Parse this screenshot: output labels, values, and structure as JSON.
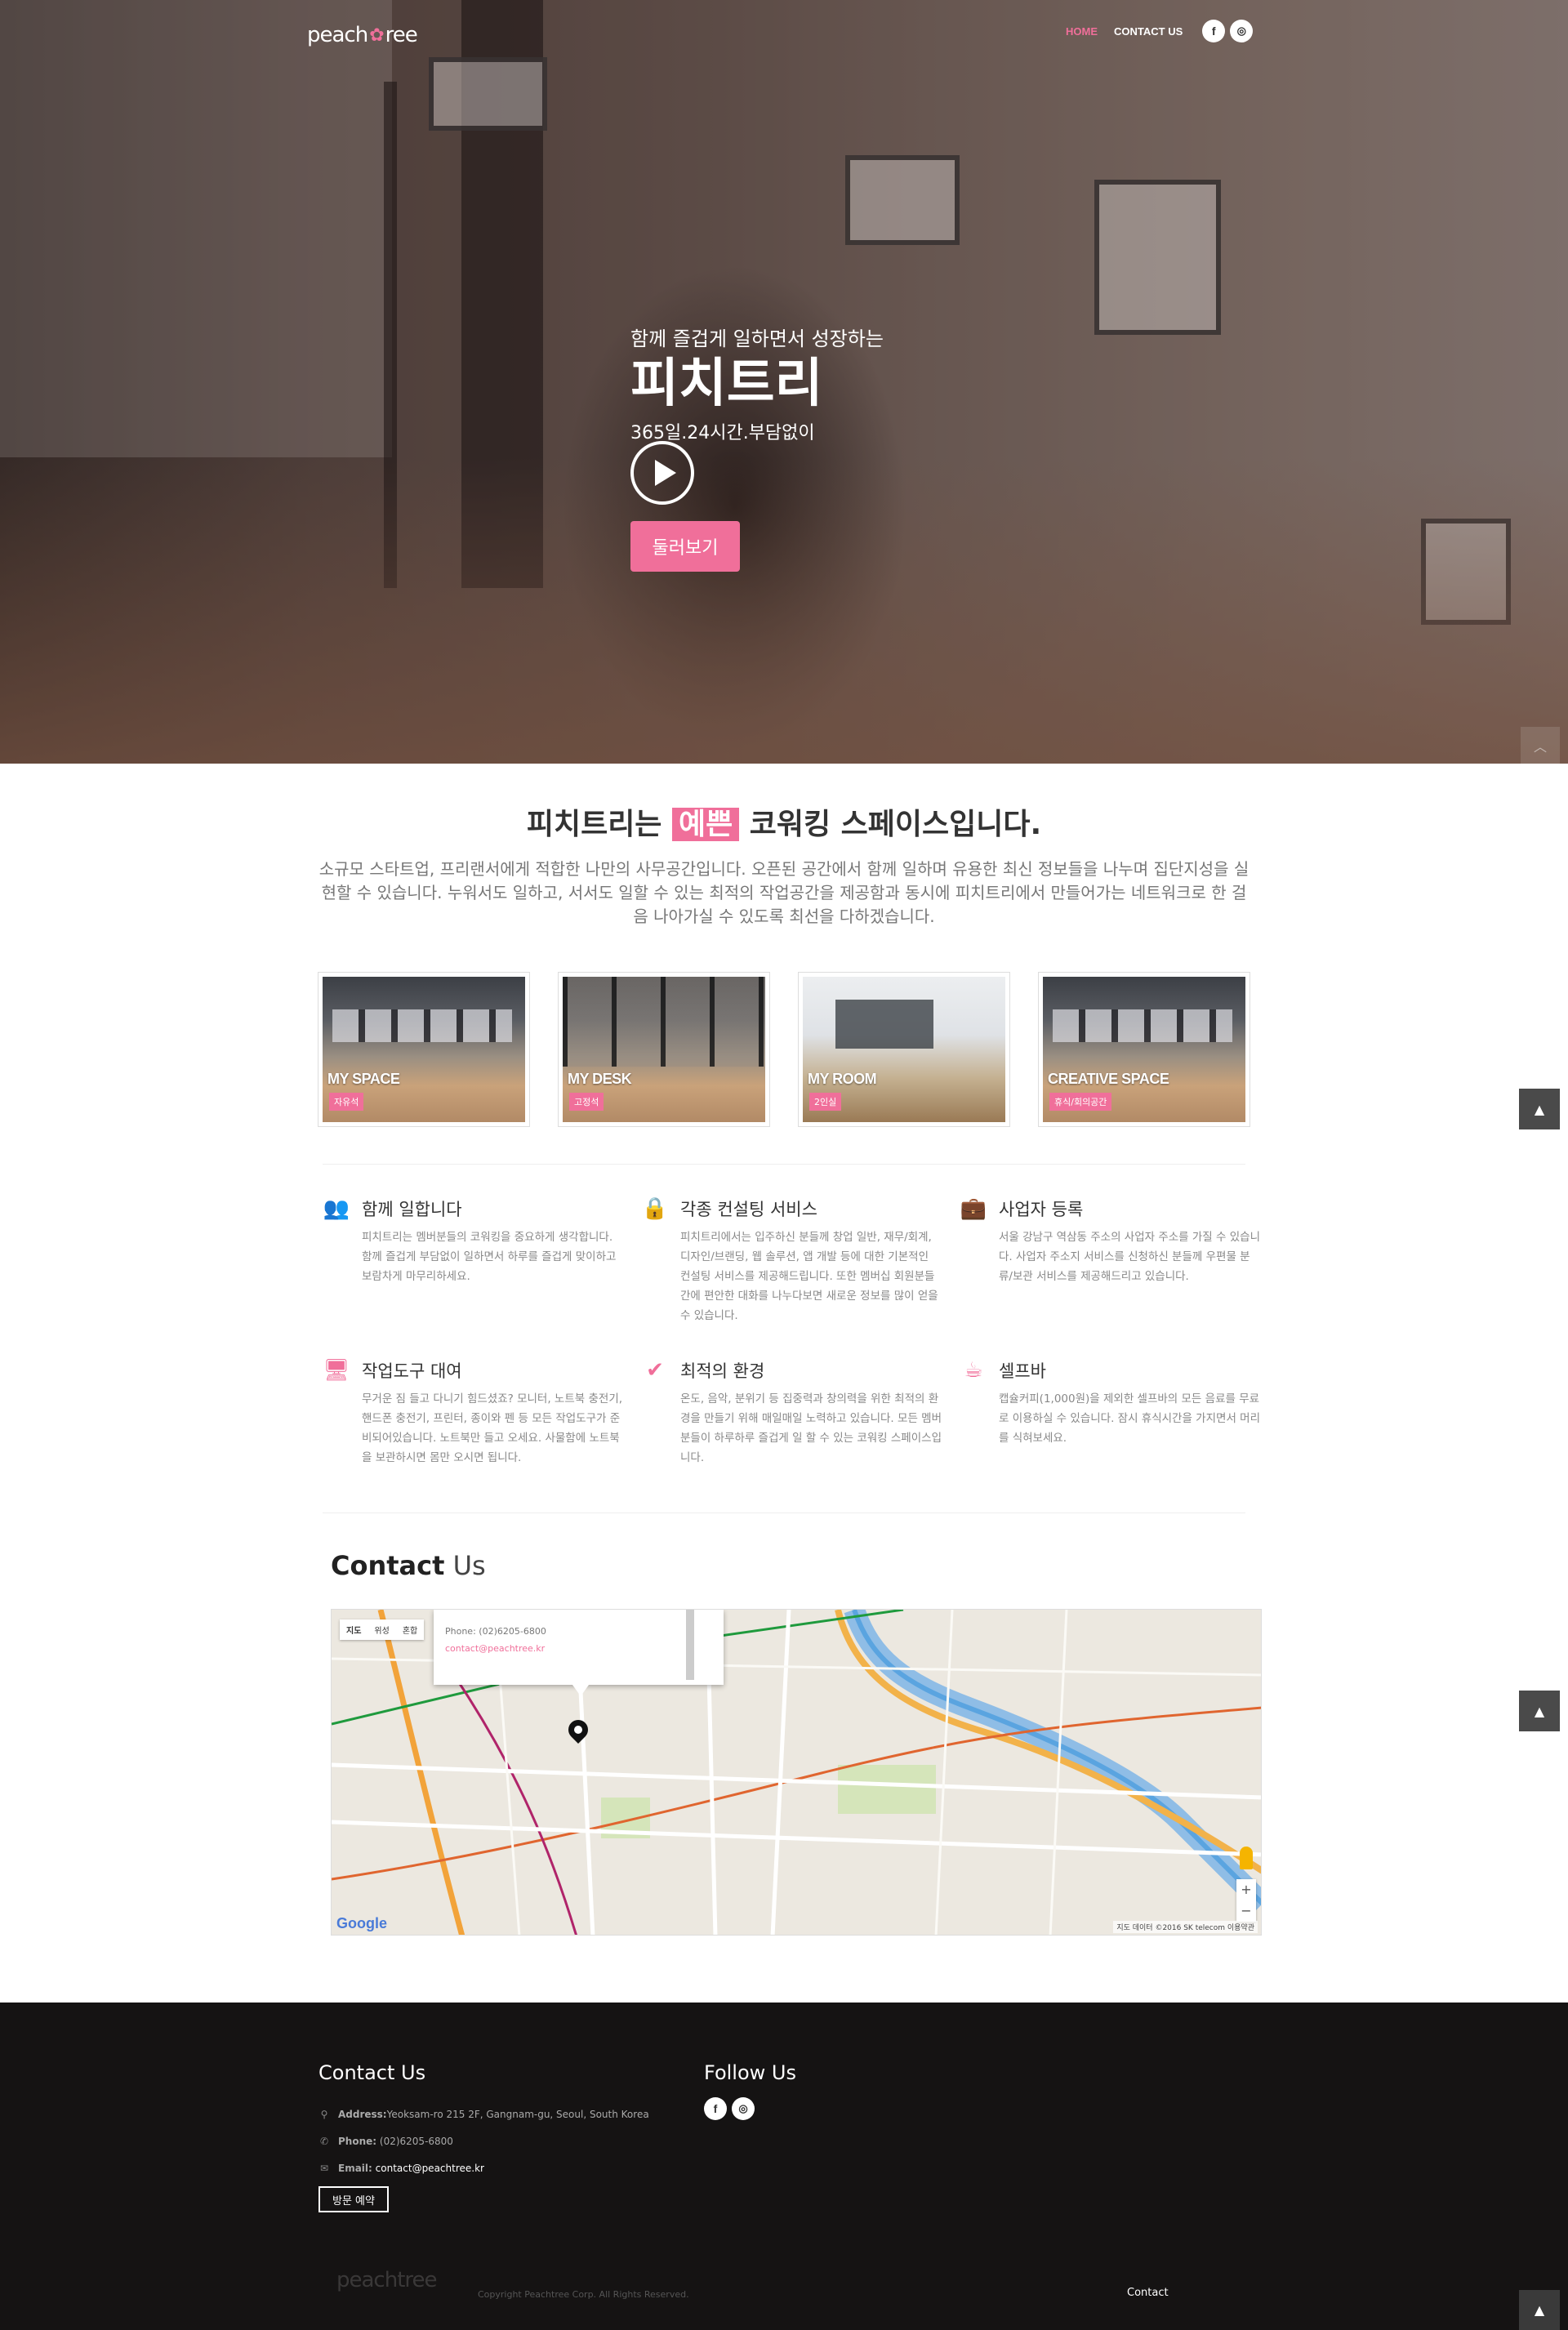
{
  "header": {
    "logo_text_left": "peach",
    "logo_text_right": "ree",
    "nav": [
      {
        "label": "HOME",
        "active": true
      },
      {
        "label": "CONTACT US",
        "active": false
      }
    ],
    "social": [
      "f",
      "◎"
    ]
  },
  "hero": {
    "subtitle": "함께 즐겁게 일하면서 성장하는",
    "title": "피치트리",
    "line": "365일.24시간.부담없이",
    "button": "둘러보기",
    "play_icon": "play-icon"
  },
  "intro": {
    "title_before": "피치트리는 ",
    "title_highlight": "예쁜",
    "title_after": " 코워킹 스페이스입니다.",
    "description": "소규모 스타트업, 프리랜서에게 적합한 나만의 사무공간입니다. 오픈된 공간에서 함께 일하며 유용한 최신 정보들을 나누며 집단지성을 실현할 수 있습니다. 누워서도 일하고, 서서도 일할 수 있는 최적의 작업공간을 제공함과 동시에 피치트리에서 만들어가는 네트워크로 한 걸음 나아가실 수 있도록 최선을 다하겠습니다."
  },
  "spaces": [
    {
      "name": "MY SPACE",
      "tag": "자유석"
    },
    {
      "name": "MY DESK",
      "tag": "고정석"
    },
    {
      "name": "MY ROOM",
      "tag": "2인실"
    },
    {
      "name": "CREATIVE SPACE",
      "tag": "휴식/회의공간"
    }
  ],
  "features": [
    {
      "icon": "users-icon",
      "glyph": "👥",
      "title": "함께 일합니다",
      "text": "피치트리는 멤버분들의 코워킹을 중요하게 생각합니다. 함께 즐겁게 부담없이 일하면서 하루를 즐겁게 맞이하고 보람차게 마무리하세요."
    },
    {
      "icon": "lock-icon",
      "glyph": "🔒",
      "title": "각종 컨설팅 서비스",
      "text": "피치트리에서는 입주하신 분들께 창업 일반, 재무/회계, 디자인/브랜딩, 웹 솔루션, 앱 개발 등에 대한 기본적인 컨설팅 서비스를 제공해드립니다. 또한 멤버십 회원분들간에 편안한 대화를 나누다보면 새로운 정보를 많이 얻을 수 있습니다."
    },
    {
      "icon": "briefcase-icon",
      "glyph": "💼",
      "title": "사업자 등록",
      "text": "서울 강남구 역삼동 주소의 사업자 주소를 가질 수 있습니다. 사업자 주소지 서비스를 신청하신 분들께 우편물 분류/보관 서비스를 제공해드리고 있습니다."
    },
    {
      "icon": "monitor-icon",
      "glyph": "🖥",
      "title": "작업도구 대여",
      "text": "무거운 짐 들고 다니기 힘드셨죠? 모니터, 노트북 충전기, 핸드폰 충전기, 프린터, 종이와 펜 등 모든 작업도구가 준비되어있습니다. 노트북만 들고 오세요. 사물함에 노트북을 보관하시면 몸만 오시면 됩니다."
    },
    {
      "icon": "check-icon",
      "glyph": "✔",
      "title": "최적의 환경",
      "text": "온도, 음악, 분위기 등 집중력과 창의력을 위한 최적의 환경을 만들기 위해 매일매일 노력하고 있습니다. 모든 멤버분들이 하루하루 즐겁게 일 할 수 있는 코워킹 스페이스입니다."
    },
    {
      "icon": "coffee-icon",
      "glyph": "☕",
      "title": "셀프바",
      "text": "캡슐커피(1,000원)을 제외한 셀프바의 모든 음료를 무료로 이용하실 수 있습니다. 잠시 휴식시간을 가지면서 머리를 식혀보세요."
    }
  ],
  "contact": {
    "title_bold": "Contact",
    "title_rest": " Us",
    "map": {
      "type_options": [
        "지도",
        "위성",
        "혼합"
      ],
      "info_phone": "Phone: (02)6205-6800",
      "info_email": "contact@peachtree.kr",
      "google": "Google",
      "credit": "지도 데이터 ©2016 SK telecom   이용약관",
      "zoom_in": "+",
      "zoom_out": "−"
    }
  },
  "footer": {
    "contact_title": "Contact Us",
    "address_label": "Address:",
    "address": "Yeoksam-ro 215 2F, Gangnam-gu, Seoul, South Korea",
    "phone_label": "Phone:",
    "phone": "(02)6205-6800",
    "email_label": "Email:",
    "email": "contact@peachtree.kr",
    "visit_button": "방문 예약",
    "follow_title": "Follow Us",
    "logo_text": "peachtree",
    "copyright": "Copyright Peachtree Corp. All Rights Reserved.",
    "contact_link": "Contact"
  },
  "colors": {
    "accent": "#f06f9a",
    "footer_bg": "#151313"
  }
}
